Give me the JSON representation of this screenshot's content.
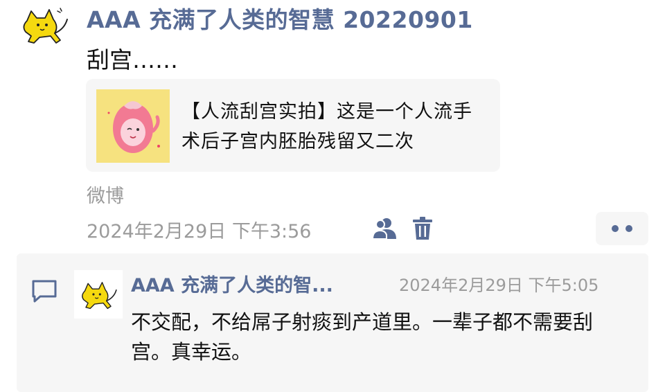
{
  "post": {
    "author": "AAA 充满了人类的智慧 20220901",
    "text": "刮宫……",
    "link_card": {
      "title": "【人流刮宫实拍】这是一个人流手术后子宫内胚胎残留又二次"
    },
    "source": "微博",
    "time": "2024年2月29日 下午3:56",
    "icons": {
      "avatar": "yellow-cat-avatar",
      "visibility": "people-icon",
      "delete": "trash-icon",
      "more": "more-dots-icon"
    }
  },
  "comment": {
    "author": "AAA 充满了人类的智...",
    "time": "2024年2月29日 下午5:05",
    "text": "不交配，不给屌子射痰到产道里。一辈子都不需要刮宫。真幸运。",
    "icon": "comment-icon"
  },
  "colors": {
    "link": "#576b95",
    "secondary_text": "#9b9b9b",
    "card_bg": "#f6f6f6",
    "avatar_yellow": "#f5d90f"
  }
}
